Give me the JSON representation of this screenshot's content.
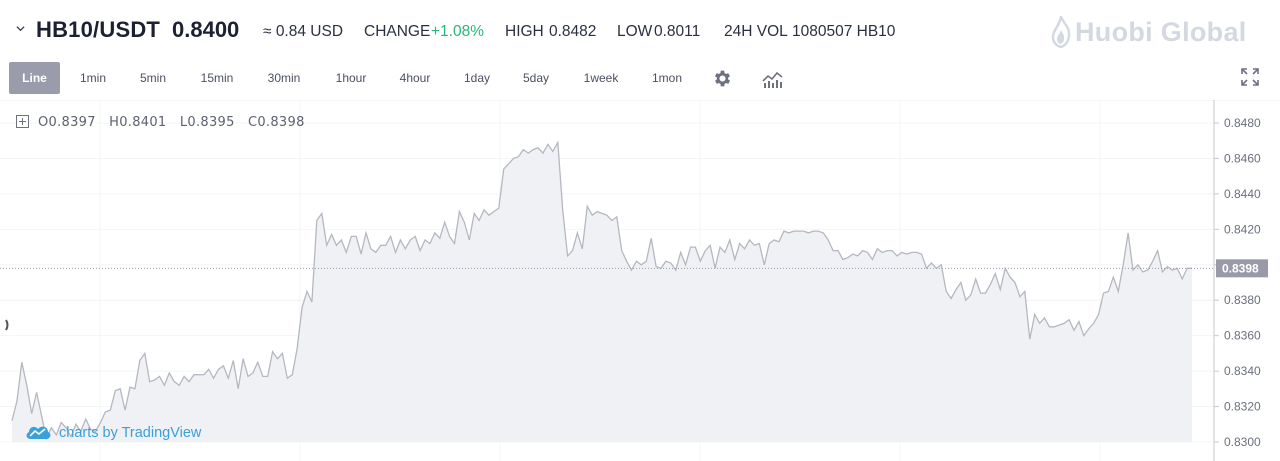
{
  "header": {
    "pair": "HB10/USDT",
    "price": "0.8400",
    "usd": "≈ 0.84 USD",
    "change_label": "CHANGE",
    "change_value": "+1.08%",
    "high_label": "HIGH",
    "high_value": "0.8482",
    "low_label": "LOW",
    "low_value": "0.8011",
    "vol_label": "24H VOL",
    "vol_value": "1080507 HB10",
    "logo": "Huobi Global"
  },
  "toolbar": {
    "intervals": [
      "Line",
      "1min",
      "5min",
      "15min",
      "30min",
      "1hour",
      "4hour",
      "1day",
      "5day",
      "1week",
      "1mon"
    ],
    "active": "Line",
    "icons": [
      "gear-icon",
      "indicators-icon",
      "fullscreen-icon"
    ]
  },
  "legend": {
    "o": "O0.8397",
    "h": "H0.8401",
    "l": "L0.8395",
    "c": "C0.8398"
  },
  "watermark": "charts by TradingView",
  "chart_data": {
    "type": "area",
    "ylim": [
      0.8295,
      0.8488
    ],
    "y_ticks": [
      "0.8480",
      "0.8460",
      "0.8440",
      "0.8420",
      "0.8400",
      "0.8380",
      "0.8360",
      "0.8340",
      "0.8320",
      "0.8300"
    ],
    "last_price_label": "0.8398",
    "last_price": 0.8398,
    "colors": {
      "line": "#b5b8c0",
      "fill": "#f0f1f4",
      "price_tag": "#999aa8",
      "grid": "#f3f4f6"
    },
    "values": [
      0.8312,
      0.8323,
      0.8345,
      0.8332,
      0.8316,
      0.8328,
      0.8315,
      0.8302,
      0.8308,
      0.8304,
      0.8311,
      0.8308,
      0.8303,
      0.831,
      0.8306,
      0.8313,
      0.8307,
      0.8306,
      0.8311,
      0.8317,
      0.8318,
      0.8329,
      0.833,
      0.8318,
      0.8331,
      0.833,
      0.8346,
      0.835,
      0.8334,
      0.8335,
      0.8337,
      0.8332,
      0.8339,
      0.8334,
      0.8332,
      0.8337,
      0.8334,
      0.8338,
      0.8338,
      0.8338,
      0.8341,
      0.8336,
      0.8341,
      0.8343,
      0.8336,
      0.8346,
      0.833,
      0.8347,
      0.8337,
      0.8339,
      0.8345,
      0.8337,
      0.8337,
      0.8351,
      0.8347,
      0.835,
      0.8336,
      0.8338,
      0.8353,
      0.8376,
      0.8385,
      0.8379,
      0.8425,
      0.8429,
      0.8411,
      0.8417,
      0.8411,
      0.8414,
      0.8407,
      0.8416,
      0.8416,
      0.8406,
      0.8418,
      0.8409,
      0.8407,
      0.8411,
      0.8411,
      0.8416,
      0.8407,
      0.8414,
      0.8409,
      0.8414,
      0.8416,
      0.8408,
      0.8414,
      0.8412,
      0.8418,
      0.8415,
      0.8424,
      0.8416,
      0.8412,
      0.843,
      0.8424,
      0.8414,
      0.8429,
      0.8425,
      0.8431,
      0.8428,
      0.843,
      0.8432,
      0.8454,
      0.8457,
      0.846,
      0.8461,
      0.8465,
      0.8463,
      0.8465,
      0.8466,
      0.8463,
      0.8468,
      0.8464,
      0.8469,
      0.8431,
      0.8405,
      0.8408,
      0.8418,
      0.8409,
      0.8433,
      0.8428,
      0.843,
      0.8429,
      0.8428,
      0.8425,
      0.8427,
      0.8408,
      0.8402,
      0.8397,
      0.8402,
      0.84,
      0.8402,
      0.8415,
      0.8399,
      0.8398,
      0.8402,
      0.8401,
      0.8397,
      0.8407,
      0.84,
      0.841,
      0.841,
      0.8402,
      0.8408,
      0.8411,
      0.8398,
      0.841,
      0.8407,
      0.8414,
      0.8403,
      0.8412,
      0.8409,
      0.8414,
      0.8411,
      0.8412,
      0.84,
      0.8412,
      0.8414,
      0.8413,
      0.8419,
      0.8418,
      0.8419,
      0.8419,
      0.8419,
      0.8418,
      0.8419,
      0.8419,
      0.8418,
      0.8414,
      0.8408,
      0.8408,
      0.8403,
      0.8404,
      0.8406,
      0.8405,
      0.8408,
      0.8407,
      0.8403,
      0.8409,
      0.8407,
      0.8408,
      0.8408,
      0.8405,
      0.8407,
      0.8406,
      0.8407,
      0.8407,
      0.8406,
      0.8398,
      0.8401,
      0.8398,
      0.84,
      0.8385,
      0.8381,
      0.8386,
      0.839,
      0.838,
      0.8383,
      0.8392,
      0.8384,
      0.8384,
      0.8389,
      0.8395,
      0.8386,
      0.8398,
      0.8393,
      0.839,
      0.8382,
      0.8385,
      0.8358,
      0.8372,
      0.8367,
      0.837,
      0.8365,
      0.8365,
      0.8366,
      0.8367,
      0.8369,
      0.8363,
      0.8368,
      0.836,
      0.8364,
      0.8367,
      0.8372,
      0.8384,
      0.8385,
      0.8393,
      0.8385,
      0.84,
      0.8418,
      0.8397,
      0.84,
      0.8396,
      0.8397,
      0.8402,
      0.8408,
      0.8396,
      0.8399,
      0.8397,
      0.8398,
      0.8392,
      0.8398,
      0.8398
    ]
  }
}
